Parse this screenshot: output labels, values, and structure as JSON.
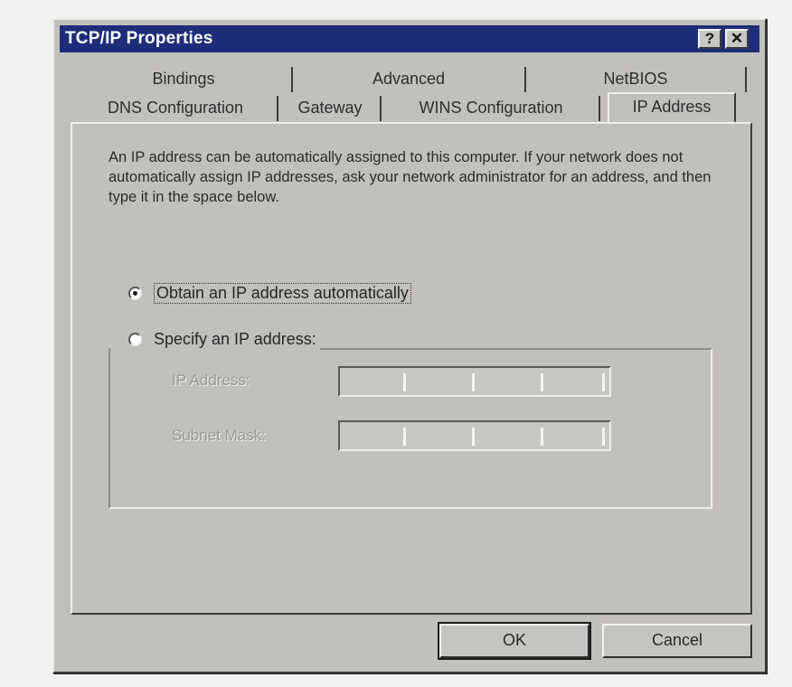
{
  "window": {
    "title": "TCP/IP Properties",
    "help_glyph": "?",
    "close_glyph": "✕"
  },
  "tabs": {
    "back_row": [
      "Bindings",
      "Advanced",
      "NetBIOS"
    ],
    "front_row": [
      "DNS Configuration",
      "Gateway",
      "WINS Configuration",
      "IP Address"
    ],
    "active": "IP Address"
  },
  "panel": {
    "description": "An IP address can be automatically assigned to this computer. If your network does not automatically assign IP addresses, ask your network administrator for an address, and then type it in the space below.",
    "radio_auto": {
      "label": "Obtain an IP address automatically",
      "checked": true
    },
    "radio_specify": {
      "label": "Specify an IP address:",
      "checked": false
    },
    "ip_address_label": "IP Address:",
    "subnet_mask_label": "Subnet Mask:",
    "ip_address_value": "",
    "subnet_mask_value": ""
  },
  "buttons": {
    "ok": "OK",
    "cancel": "Cancel"
  },
  "icons": [
    "help-icon",
    "close-icon",
    "radio-checked",
    "radio-unchecked"
  ]
}
